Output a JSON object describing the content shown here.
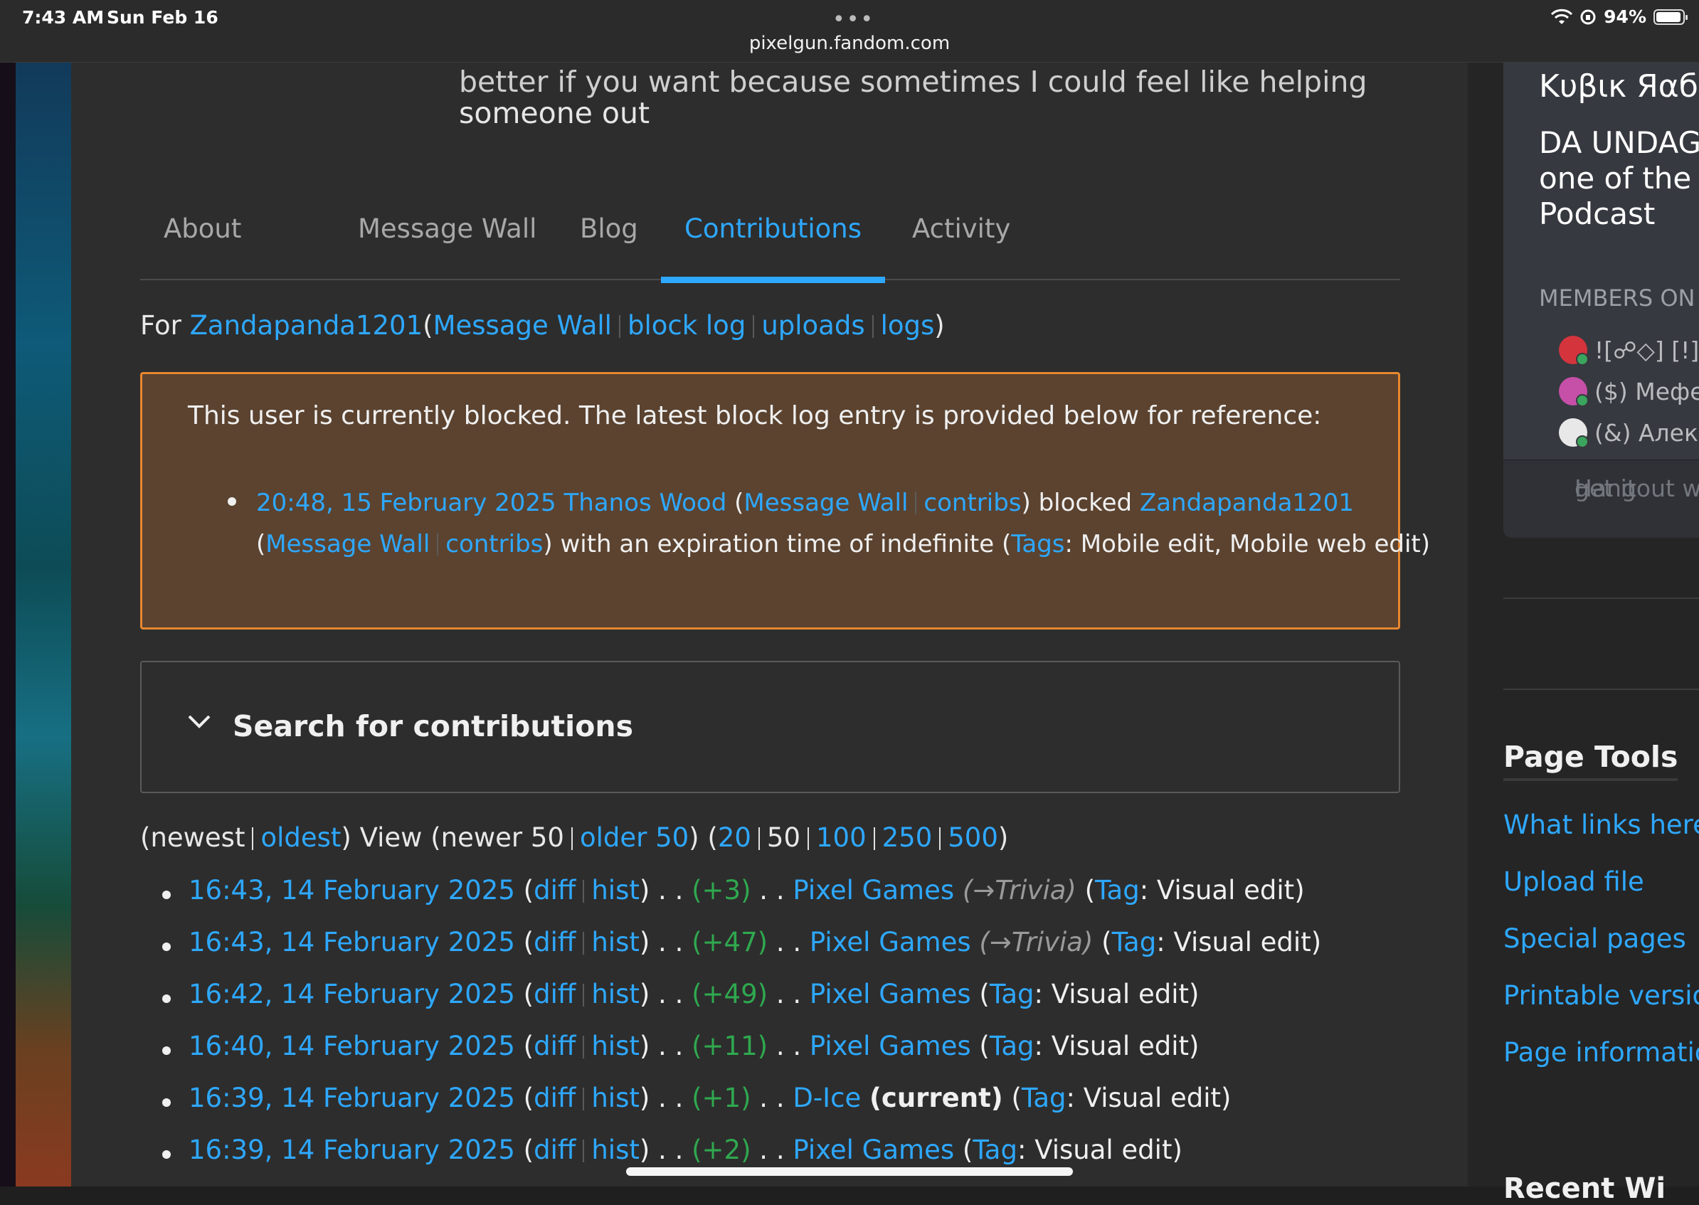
{
  "status_bar": {
    "time": "7:43 AM",
    "date": "Sun Feb 16",
    "url": "pixelgun.fandom.com",
    "battery": "94%"
  },
  "intro": {
    "clipped": "better if you want because sometimes I could feel like helping",
    "line": "someone out"
  },
  "tabs": [
    {
      "label": "About"
    },
    {
      "label": "Message Wall"
    },
    {
      "label": "Blog"
    },
    {
      "label": "Contributions"
    },
    {
      "label": "Activity"
    }
  ],
  "for_line": {
    "prefix": "For",
    "user": "Zandapanda1201",
    "links": [
      "Message Wall",
      "block log",
      "uploads",
      "logs"
    ]
  },
  "block_notice": {
    "message": "This user is currently blocked. The latest block log entry is provided below for reference:",
    "timestamp": "20:48, 15 February 2025",
    "admin": "Thanos Wood",
    "admin_links": [
      "Message Wall",
      "contribs"
    ],
    "action": "blocked",
    "target": "Zandapanda1201",
    "target_links": [
      "Message Wall",
      "contribs"
    ],
    "expiry_text": "with an expiration time of indefinite",
    "tags_label": "Tags",
    "tags": "Mobile edit, Mobile web edit"
  },
  "search_panel": {
    "label": "Search for contributions"
  },
  "pagination": {
    "newest": "newest",
    "oldest": "oldest",
    "view": "View",
    "newer": "newer 50",
    "older": "older 50",
    "limits": [
      "20",
      "50",
      "100",
      "250",
      "500"
    ]
  },
  "contributions": [
    {
      "time": "16:43, 14 February 2025",
      "size": "(+3)",
      "page": "Pixel Games",
      "section": "→Trivia",
      "current": "",
      "tag": "Visual edit"
    },
    {
      "time": "16:43, 14 February 2025",
      "size": "(+47)",
      "page": "Pixel Games",
      "section": "→Trivia",
      "current": "",
      "tag": "Visual edit"
    },
    {
      "time": "16:42, 14 February 2025",
      "size": "(+49)",
      "page": "Pixel Games",
      "section": "",
      "current": "",
      "tag": "Visual edit"
    },
    {
      "time": "16:40, 14 February 2025",
      "size": "(+11)",
      "page": "Pixel Games",
      "section": "",
      "current": "",
      "tag": "Visual edit"
    },
    {
      "time": "16:39, 14 February 2025",
      "size": "(+1)",
      "page": "D-Ice",
      "section": "",
      "current": "(current)",
      "tag": "Visual edit"
    },
    {
      "time": "16:39, 14 February 2025",
      "size": "(+2)",
      "page": "Pixel Games",
      "section": "",
      "current": "",
      "tag": "Visual edit"
    }
  ],
  "labels": {
    "diff": "diff",
    "hist": "hist",
    "tag": "Tag"
  },
  "discord": {
    "server": "Κυβικ Яαбι",
    "description": [
      "DA UNDAG",
      "one of the",
      "Podcast"
    ],
    "members_heading": "MEMBERS ON",
    "members": [
      "![☍◇] [!] r",
      "($) Мефе",
      "(&) Алекс"
    ],
    "member_colors": [
      "#d4343c",
      "#c64fa8",
      "#e8e8e8"
    ],
    "hangout": [
      "Hangout with",
      "get it"
    ]
  },
  "page_tools": {
    "title": "Page Tools",
    "items": [
      "What links here",
      "Upload file",
      "Special pages",
      "Printable version",
      "Page information"
    ]
  },
  "recent": "Recent Wi"
}
